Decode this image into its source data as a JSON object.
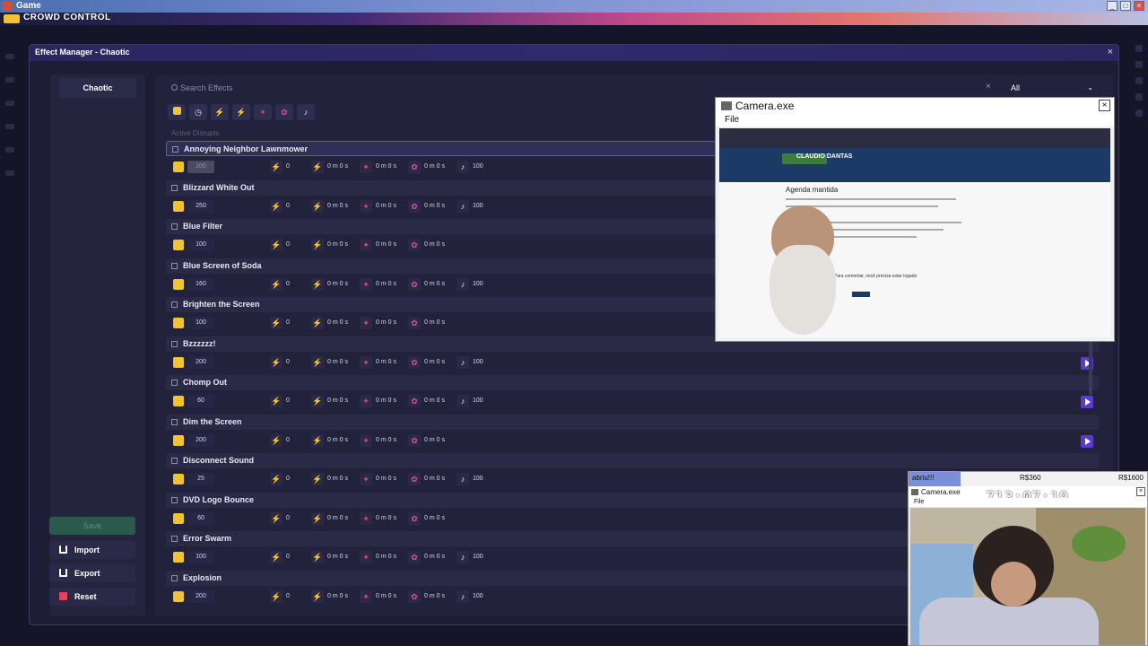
{
  "os": {
    "window_title": "Game",
    "app_banner": "CROWD CONTROL",
    "window_buttons": [
      "_",
      "□",
      "×"
    ]
  },
  "manager": {
    "title": "Effect Manager - Chaotic",
    "close": "×",
    "left_tab": "Chaotic",
    "buttons": {
      "save": "Save",
      "import": "Import",
      "export": "Export",
      "reset": "Reset"
    },
    "search": {
      "placeholder": "Search Effects",
      "clear": "×"
    },
    "filter": {
      "value": "All"
    },
    "section_label": "Active Disrupts",
    "effects": [
      {
        "name": "Annoying Neighbor Lawnmower",
        "cost": "100",
        "a": "0",
        "b": "0 m 0 s",
        "c": "0 m 0 s",
        "d": "0 m 0 s",
        "vol": "100"
      },
      {
        "name": "Blizzard White Out",
        "cost": "250",
        "a": "0",
        "b": "0 m 0 s",
        "c": "0 m 0 s",
        "d": "0 m 0 s",
        "vol": "100"
      },
      {
        "name": "Blue Filter",
        "cost": "100",
        "a": "0",
        "b": "0 m 0 s",
        "c": "0 m 0 s",
        "d": "0 m 0 s",
        "vol": ""
      },
      {
        "name": "Blue Screen of Soda",
        "cost": "160",
        "a": "0",
        "b": "0 m 0 s",
        "c": "0 m 0 s",
        "d": "0 m 0 s",
        "vol": "100"
      },
      {
        "name": "Brighten the Screen",
        "cost": "100",
        "a": "0",
        "b": "0 m 0 s",
        "c": "0 m 0 s",
        "d": "0 m 0 s",
        "vol": ""
      },
      {
        "name": "Bzzzzzz!",
        "cost": "200",
        "a": "0",
        "b": "0 m 0 s",
        "c": "0 m 0 s",
        "d": "0 m 0 s",
        "vol": "100"
      },
      {
        "name": "Chomp Out",
        "cost": "60",
        "a": "0",
        "b": "0 m 0 s",
        "c": "0 m 0 s",
        "d": "0 m 0 s",
        "vol": "100"
      },
      {
        "name": "Dim the Screen",
        "cost": "200",
        "a": "0",
        "b": "0 m 0 s",
        "c": "0 m 0 s",
        "d": "0 m 0 s",
        "vol": ""
      },
      {
        "name": "Disconnect Sound",
        "cost": "25",
        "a": "0",
        "b": "0 m 0 s",
        "c": "0 m 0 s",
        "d": "0 m 0 s",
        "vol": "100"
      },
      {
        "name": "DVD Logo Bounce",
        "cost": "60",
        "a": "0",
        "b": "0 m 0 s",
        "c": "0 m 0 s",
        "d": "0 m 0 s",
        "vol": ""
      },
      {
        "name": "Error Swarm",
        "cost": "100",
        "a": "0",
        "b": "0 m 0 s",
        "c": "0 m 0 s",
        "d": "0 m 0 s",
        "vol": "100"
      },
      {
        "name": "Explosion",
        "cost": "200",
        "a": "0",
        "b": "0 m 0 s",
        "c": "0 m 0 s",
        "d": "0 m 0 s",
        "vol": "100"
      }
    ]
  },
  "camera1": {
    "title": "Camera.exe",
    "menu": "File",
    "site_brand": "CLAUDIO DANTAS",
    "site_heading": "Agenda mantida",
    "comment_box": "Para comentar, você precisa estar logado"
  },
  "camera2": {
    "ticker_left": "abriu!!!",
    "ticker_mid": "R$360",
    "ticker_right": "R$1600",
    "title": "Camera.exe",
    "menu": "File",
    "timer": "713:07:19"
  },
  "colors": {
    "accent": "#5a3ad0",
    "coin": "#f2c330",
    "lightning": "#f2b51c",
    "red": "#e2455a",
    "pink": "#d94fa7"
  }
}
